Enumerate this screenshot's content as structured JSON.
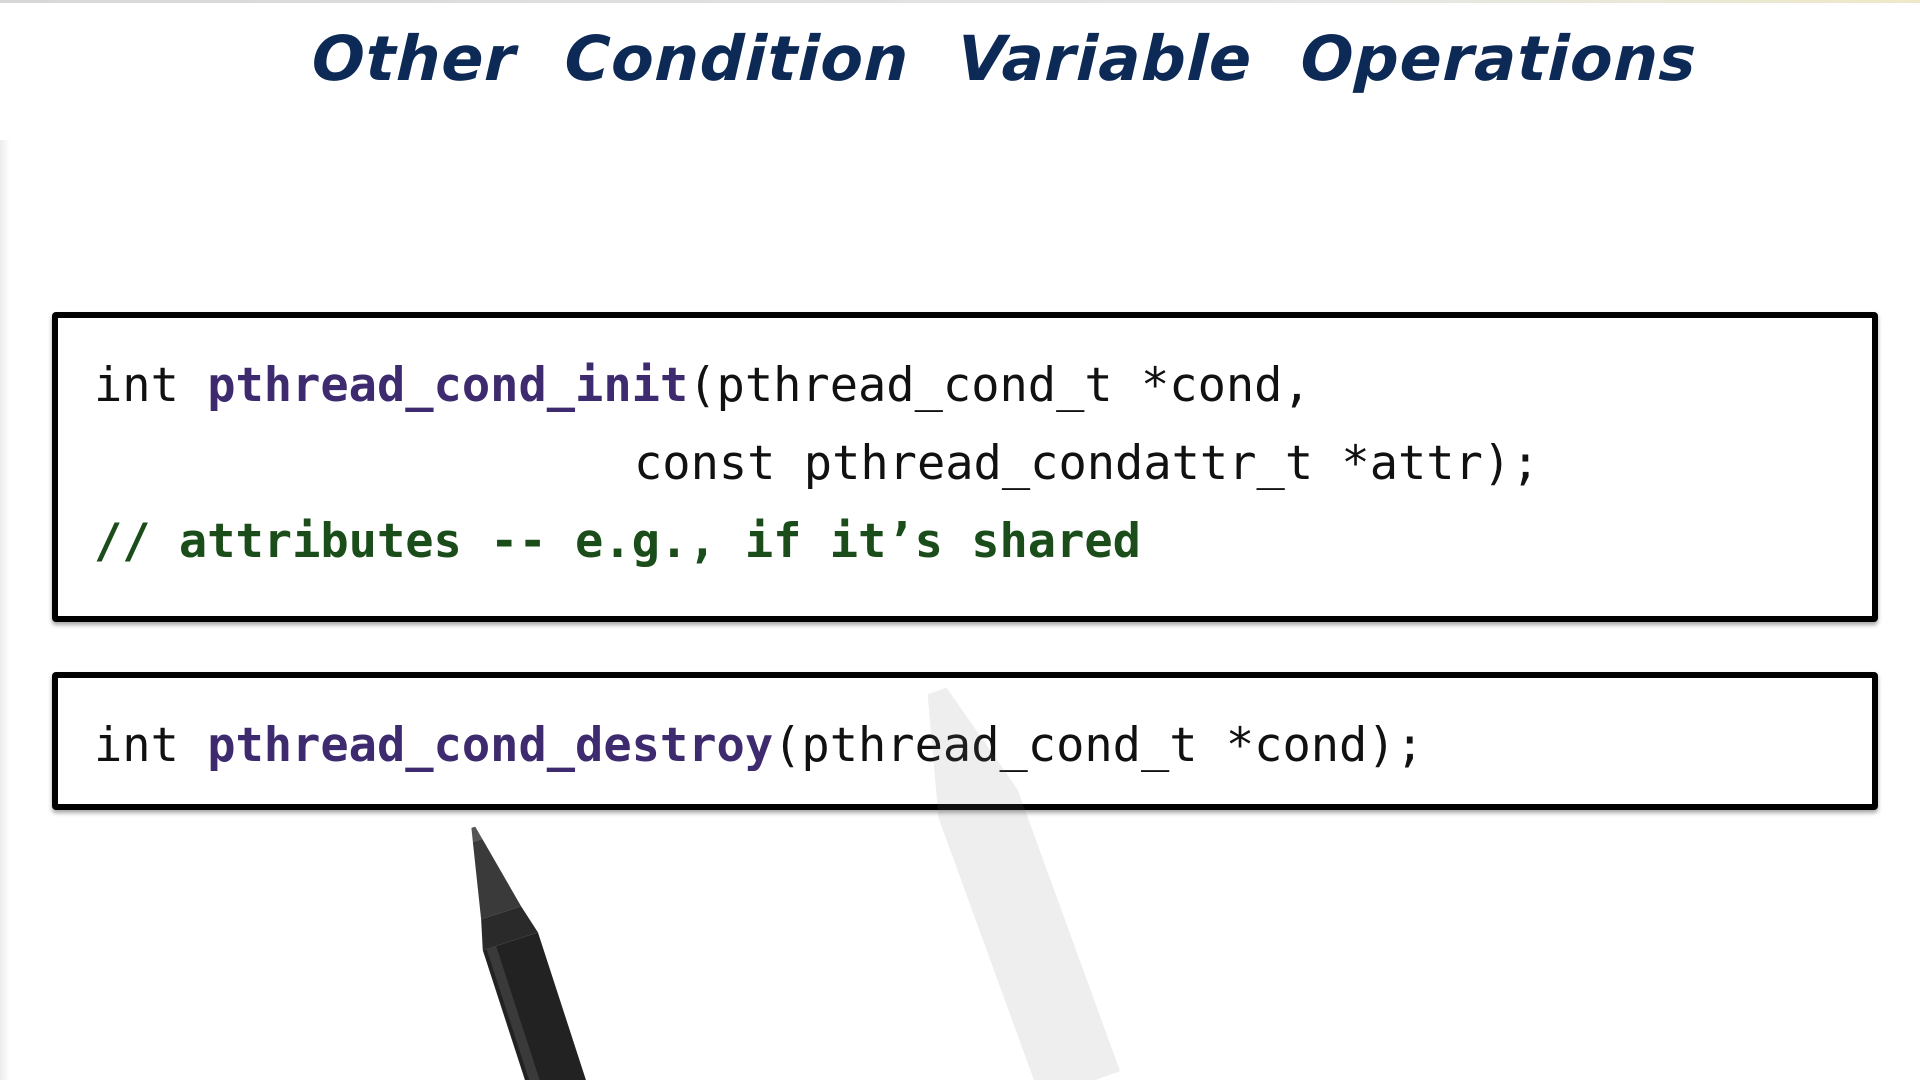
{
  "title": "Other Condition Variable Operations",
  "code_blocks": [
    {
      "lines": [
        {
          "type_kw": "int ",
          "func": "pthread_cond_init",
          "rest": "(pthread_cond_t *cond,"
        },
        {
          "rest": "const pthread_condattr_t *attr);"
        },
        {
          "comment": "// attributes -- e.g., if it’s shared"
        }
      ]
    },
    {
      "lines": [
        {
          "type_kw": "int ",
          "func": "pthread_cond_destroy",
          "rest": "(pthread_cond_t *cond);"
        }
      ]
    }
  ],
  "colors": {
    "title": "#0d2a56",
    "function_name": "#3e2a6e",
    "comment": "#1a4d1a",
    "code_text": "#111111"
  }
}
